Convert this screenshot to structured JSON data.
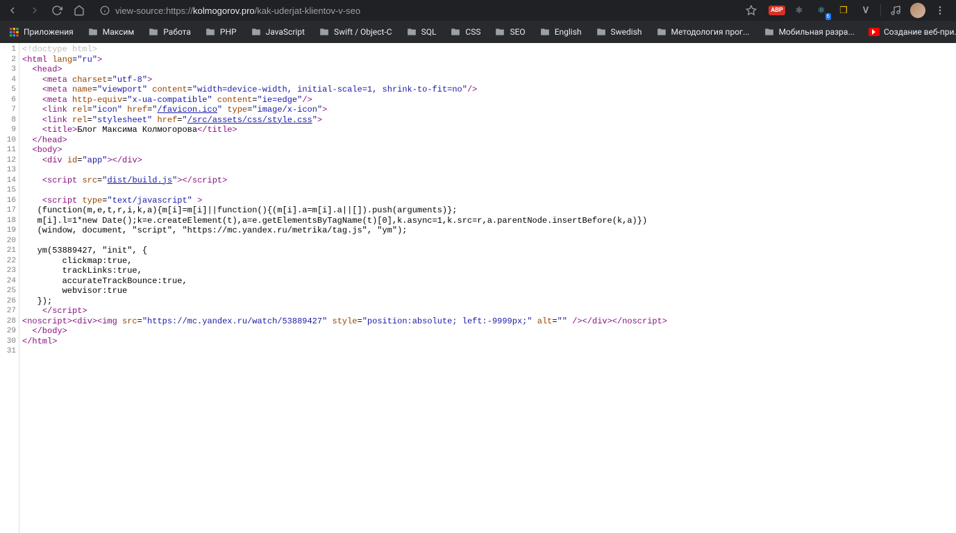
{
  "toolbar": {
    "url_prefix": "view-source:https://",
    "url_domain": "kolmogorov.pro",
    "url_path": "/kak-uderjat-klientov-v-seo",
    "ext_badge": "ABP",
    "notif_count": "6"
  },
  "bookmarks": {
    "apps": "Приложения",
    "items": [
      "Максим",
      "Работа",
      "PHP",
      "JavaScript",
      "Swift / Object-C",
      "SQL",
      "CSS",
      "SEO",
      "English",
      "Swedish",
      "Методология прог...",
      "Мобильная разра..."
    ],
    "yt": "Создание веб-при..."
  },
  "source": {
    "line_count": 31,
    "lines": [
      {
        "n": 1,
        "html": "<span class='c-doctype'>&lt;!doctype html&gt;</span>"
      },
      {
        "n": 2,
        "html": "<span class='c-tag'>&lt;html</span> <span class='c-attr'>lang</span>=<span class='c-val'>\"ru\"</span><span class='c-tag'>&gt;</span>"
      },
      {
        "n": 3,
        "html": "  <span class='c-tag'>&lt;head&gt;</span>"
      },
      {
        "n": 4,
        "html": "    <span class='c-tag'>&lt;meta</span> <span class='c-attr'>charset</span>=<span class='c-val'>\"utf-8\"</span><span class='c-tag'>&gt;</span>"
      },
      {
        "n": 5,
        "html": "    <span class='c-tag'>&lt;meta</span> <span class='c-attr'>name</span>=<span class='c-val'>\"viewport\"</span> <span class='c-attr'>content</span>=<span class='c-val'>\"width=device-width, initial-scale=1, shrink-to-fit=no\"</span><span class='c-tag'>/&gt;</span>"
      },
      {
        "n": 6,
        "html": "    <span class='c-tag'>&lt;meta</span> <span class='c-attr'>http-equiv</span>=<span class='c-val'>\"x-ua-compatible\"</span> <span class='c-attr'>content</span>=<span class='c-val'>\"ie=edge\"</span><span class='c-tag'>/&gt;</span>"
      },
      {
        "n": 7,
        "html": "    <span class='c-tag'>&lt;link</span> <span class='c-attr'>rel</span>=<span class='c-val'>\"icon\"</span> <span class='c-attr'>href</span>=<span class='c-val'>\"<span class='c-link'>/favicon.ico</span>\"</span> <span class='c-attr'>type</span>=<span class='c-val'>\"image/x-icon\"</span><span class='c-tag'>&gt;</span>"
      },
      {
        "n": 8,
        "html": "    <span class='c-tag'>&lt;link</span> <span class='c-attr'>rel</span>=<span class='c-val'>\"stylesheet\"</span> <span class='c-attr'>href</span>=<span class='c-val'>\"<span class='c-link'>/src/assets/css/style.css</span>\"</span><span class='c-tag'>&gt;</span>"
      },
      {
        "n": 9,
        "html": "    <span class='c-tag'>&lt;title&gt;</span><span class='c-text'>Блог Максима Колмогорова</span><span class='c-tag'>&lt;/title&gt;</span>"
      },
      {
        "n": 10,
        "html": "  <span class='c-tag'>&lt;/head&gt;</span>"
      },
      {
        "n": 11,
        "html": "  <span class='c-tag'>&lt;body&gt;</span>"
      },
      {
        "n": 12,
        "html": "    <span class='c-tag'>&lt;div</span> <span class='c-attr'>id</span>=<span class='c-val'>\"app\"</span><span class='c-tag'>&gt;&lt;/div&gt;</span>"
      },
      {
        "n": 13,
        "html": ""
      },
      {
        "n": 14,
        "html": "    <span class='c-tag'>&lt;script</span> <span class='c-attr'>src</span>=<span class='c-val'>\"<span class='c-link'>dist/build.js</span>\"</span><span class='c-tag'>&gt;&lt;/script&gt;</span>"
      },
      {
        "n": 15,
        "html": ""
      },
      {
        "n": 16,
        "html": "    <span class='c-tag'>&lt;script</span> <span class='c-attr'>type</span>=<span class='c-val'>\"text/javascript\"</span> <span class='c-tag'>&gt;</span>"
      },
      {
        "n": 17,
        "html": "   (function(m,e,t,r,i,k,a){m[i]=m[i]||function(){(m[i].a=m[i].a||[]).push(arguments)};"
      },
      {
        "n": 18,
        "html": "   m[i].l=1*new Date();k=e.createElement(t),a=e.getElementsByTagName(t)[0],k.async=1,k.src=r,a.parentNode.insertBefore(k,a)})"
      },
      {
        "n": 19,
        "html": "   (window, document, \"script\", \"https://mc.yandex.ru/metrika/tag.js\", \"ym\");"
      },
      {
        "n": 20,
        "html": ""
      },
      {
        "n": 21,
        "html": "   ym(53889427, \"init\", {"
      },
      {
        "n": 22,
        "html": "        clickmap:true,"
      },
      {
        "n": 23,
        "html": "        trackLinks:true,"
      },
      {
        "n": 24,
        "html": "        accurateTrackBounce:true,"
      },
      {
        "n": 25,
        "html": "        webvisor:true"
      },
      {
        "n": 26,
        "html": "   });"
      },
      {
        "n": 27,
        "html": "    <span class='c-tag'>&lt;/script&gt;</span>"
      },
      {
        "n": 28,
        "html": "<span class='c-tag'>&lt;noscript&gt;&lt;div&gt;&lt;img</span> <span class='c-attr'>src</span>=<span class='c-val'>\"https://mc.yandex.ru/watch/53889427\"</span> <span class='c-attr'>style</span>=<span class='c-val'>\"position:absolute; left:-9999px;\"</span> <span class='c-attr'>alt</span>=<span class='c-val'>\"\"</span> <span class='c-tag'>/&gt;&lt;/div&gt;&lt;/noscript&gt;</span>"
      },
      {
        "n": 29,
        "html": "  <span class='c-tag'>&lt;/body&gt;</span>"
      },
      {
        "n": 30,
        "html": "<span class='c-tag'>&lt;/html&gt;</span>"
      },
      {
        "n": 31,
        "html": ""
      }
    ]
  }
}
